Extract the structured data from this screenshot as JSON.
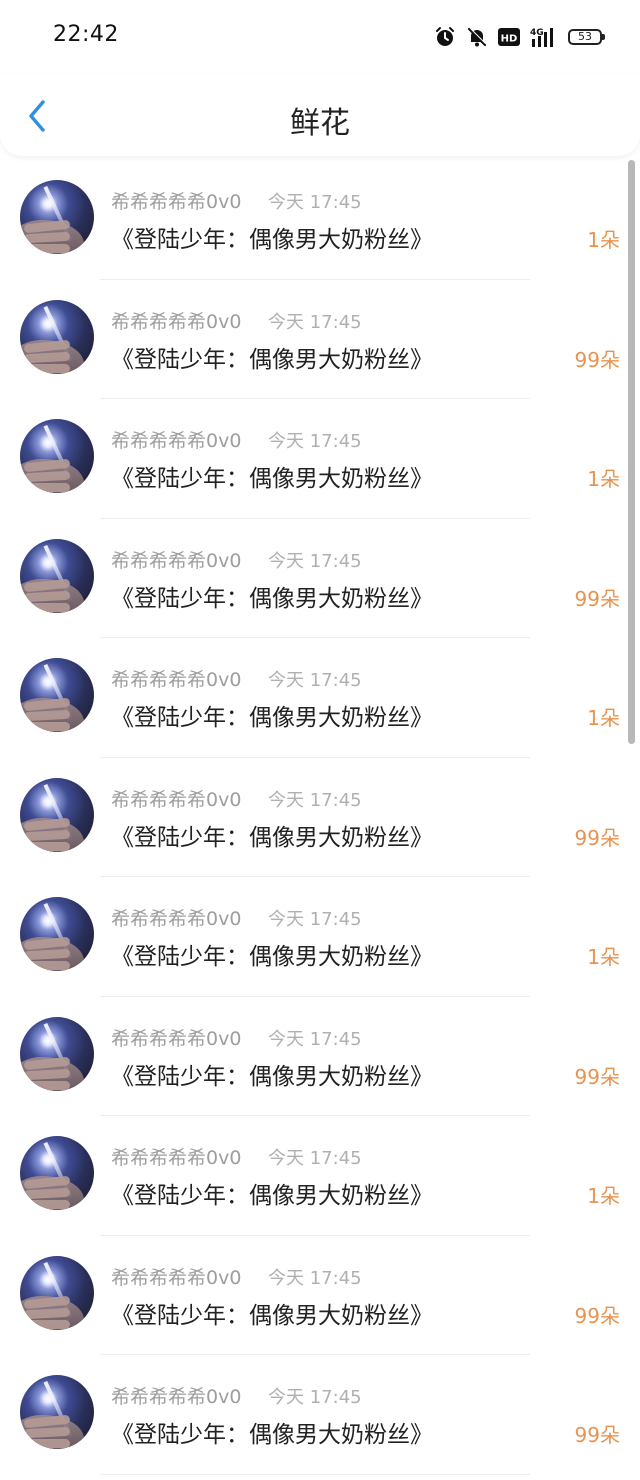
{
  "status_bar": {
    "time": "22:42",
    "battery": "53",
    "icons": [
      "alarm-icon",
      "bell-muted-icon",
      "hd-icon",
      "4g-signal-icon",
      "battery-icon"
    ]
  },
  "nav": {
    "back_icon": "chevron-left-icon",
    "title": "鲜花"
  },
  "colors": {
    "accent_back": "#2f8fe0",
    "amount": "#e89350"
  },
  "records": [
    {
      "user": "希希希希希0v0",
      "time": "今天 17:45",
      "title": "《登陆少年：偶像男大奶粉丝》",
      "amount": "1朵"
    },
    {
      "user": "希希希希希0v0",
      "time": "今天 17:45",
      "title": "《登陆少年：偶像男大奶粉丝》",
      "amount": "99朵"
    },
    {
      "user": "希希希希希0v0",
      "time": "今天 17:45",
      "title": "《登陆少年：偶像男大奶粉丝》",
      "amount": "1朵"
    },
    {
      "user": "希希希希希0v0",
      "time": "今天 17:45",
      "title": "《登陆少年：偶像男大奶粉丝》",
      "amount": "99朵"
    },
    {
      "user": "希希希希希0v0",
      "time": "今天 17:45",
      "title": "《登陆少年：偶像男大奶粉丝》",
      "amount": "1朵"
    },
    {
      "user": "希希希希希0v0",
      "time": "今天 17:45",
      "title": "《登陆少年：偶像男大奶粉丝》",
      "amount": "99朵"
    },
    {
      "user": "希希希希希0v0",
      "time": "今天 17:45",
      "title": "《登陆少年：偶像男大奶粉丝》",
      "amount": "1朵"
    },
    {
      "user": "希希希希希0v0",
      "time": "今天 17:45",
      "title": "《登陆少年：偶像男大奶粉丝》",
      "amount": "99朵"
    },
    {
      "user": "希希希希希0v0",
      "time": "今天 17:45",
      "title": "《登陆少年：偶像男大奶粉丝》",
      "amount": "1朵"
    },
    {
      "user": "希希希希希0v0",
      "time": "今天 17:45",
      "title": "《登陆少年：偶像男大奶粉丝》",
      "amount": "99朵"
    },
    {
      "user": "希希希希希0v0",
      "time": "今天 17:45",
      "title": "《登陆少年：偶像男大奶粉丝》",
      "amount": "99朵"
    }
  ]
}
